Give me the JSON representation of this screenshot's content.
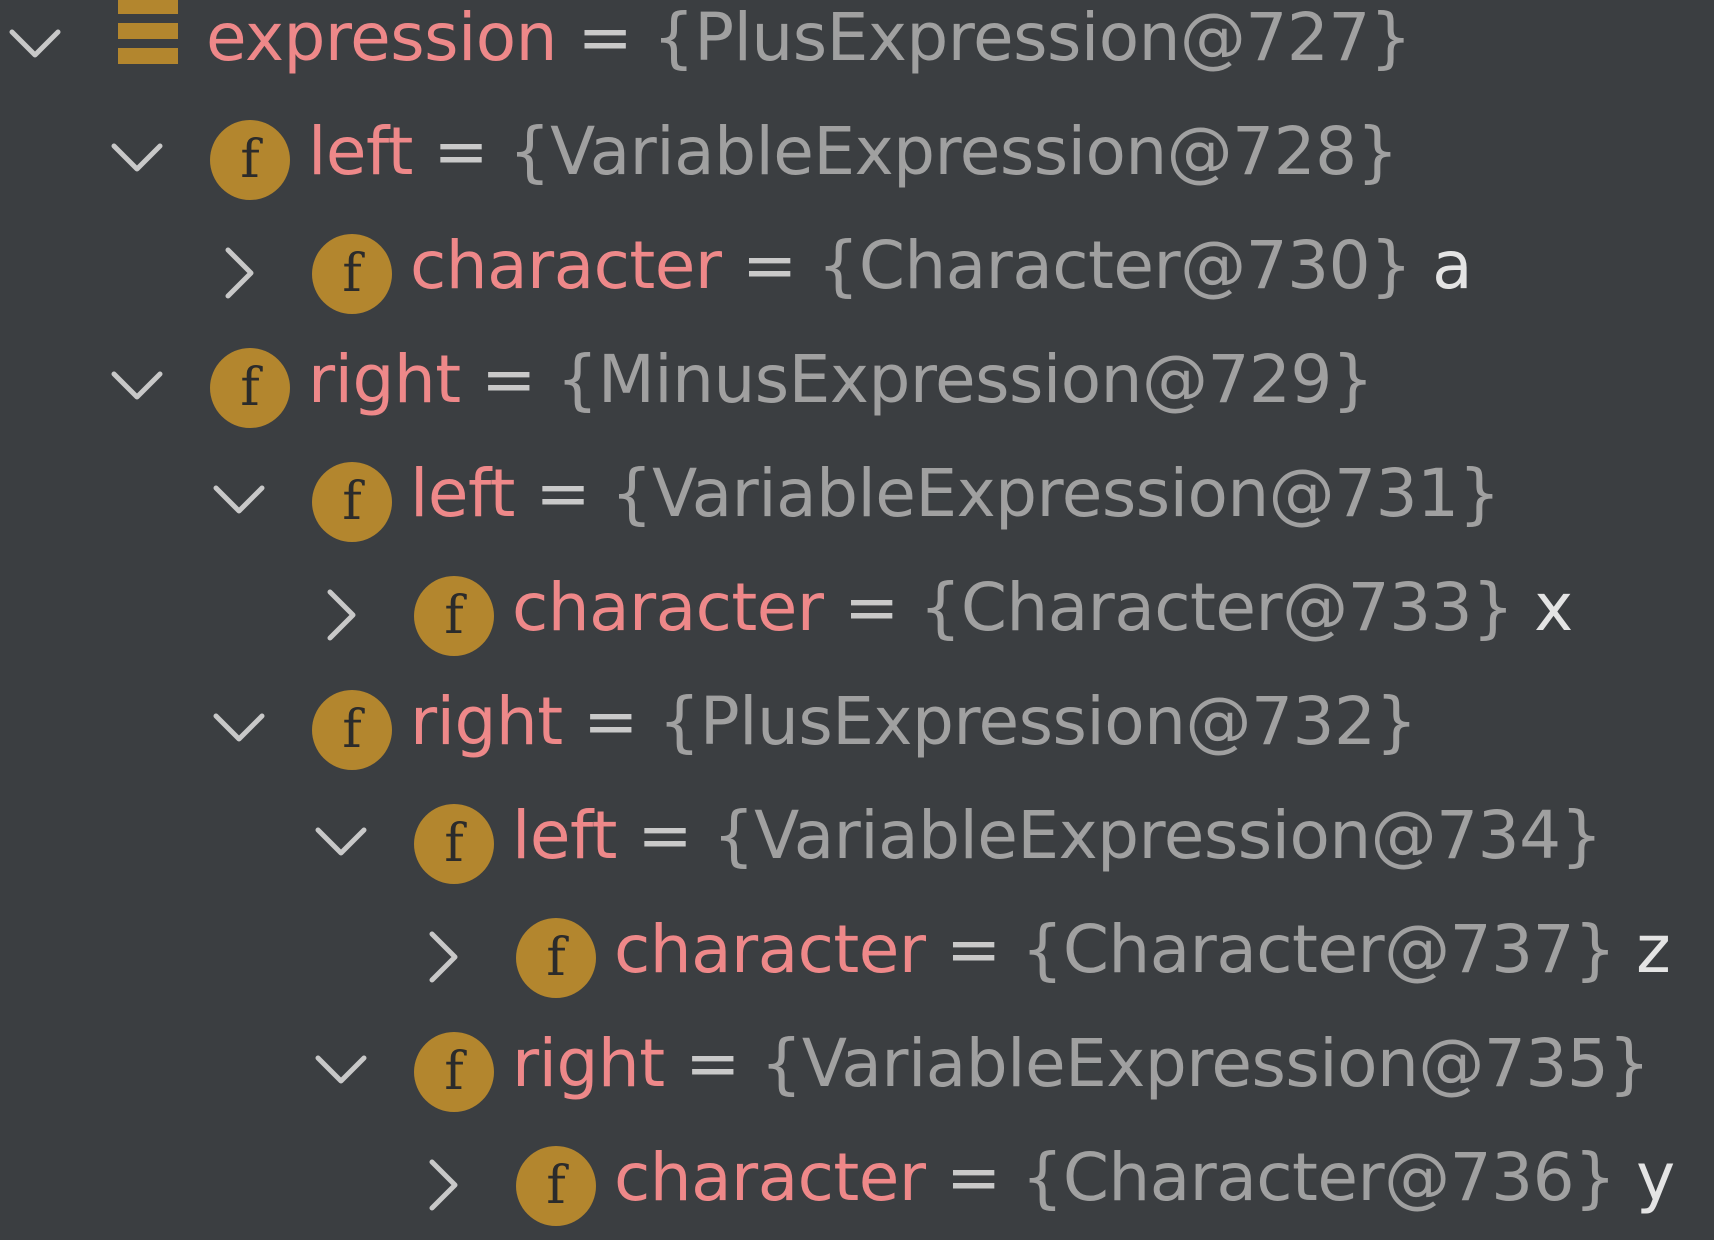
{
  "colors": {
    "background": "#3b3e41",
    "field_name": "#ee8889",
    "type_value": "#a0a0a0",
    "equals": "#c9c9c9",
    "extra_value": "#e4e4e4",
    "field_badge": "#b3862e",
    "chevron": "#c8c8c8"
  },
  "icons": {
    "root": "variable-stack-icon",
    "field": "field-f-icon",
    "expanded": "chevron-down-icon",
    "collapsed": "chevron-right-icon",
    "field_badge_letter": "f"
  },
  "tree": [
    {
      "depth": 0,
      "expanded": true,
      "icon": "root",
      "name": "expression",
      "equals": "=",
      "value": "{PlusExpression@727}",
      "extra": ""
    },
    {
      "depth": 1,
      "expanded": true,
      "icon": "field",
      "name": "left",
      "equals": "=",
      "value": "{VariableExpression@728}",
      "extra": ""
    },
    {
      "depth": 2,
      "expanded": false,
      "icon": "field",
      "name": "character",
      "equals": "=",
      "value": "{Character@730}",
      "extra": "a"
    },
    {
      "depth": 1,
      "expanded": true,
      "icon": "field",
      "name": "right",
      "equals": "=",
      "value": "{MinusExpression@729}",
      "extra": ""
    },
    {
      "depth": 2,
      "expanded": true,
      "icon": "field",
      "name": "left",
      "equals": "=",
      "value": "{VariableExpression@731}",
      "extra": ""
    },
    {
      "depth": 3,
      "expanded": false,
      "icon": "field",
      "name": "character",
      "equals": "=",
      "value": "{Character@733}",
      "extra": "x"
    },
    {
      "depth": 2,
      "expanded": true,
      "icon": "field",
      "name": "right",
      "equals": "=",
      "value": "{PlusExpression@732}",
      "extra": ""
    },
    {
      "depth": 3,
      "expanded": true,
      "icon": "field",
      "name": "left",
      "equals": "=",
      "value": "{VariableExpression@734}",
      "extra": ""
    },
    {
      "depth": 4,
      "expanded": false,
      "icon": "field",
      "name": "character",
      "equals": "=",
      "value": "{Character@737}",
      "extra": "z"
    },
    {
      "depth": 3,
      "expanded": true,
      "icon": "field",
      "name": "right",
      "equals": "=",
      "value": "{VariableExpression@735}",
      "extra": ""
    },
    {
      "depth": 4,
      "expanded": false,
      "icon": "field",
      "name": "character",
      "equals": "=",
      "value": "{Character@736}",
      "extra": "y"
    }
  ]
}
